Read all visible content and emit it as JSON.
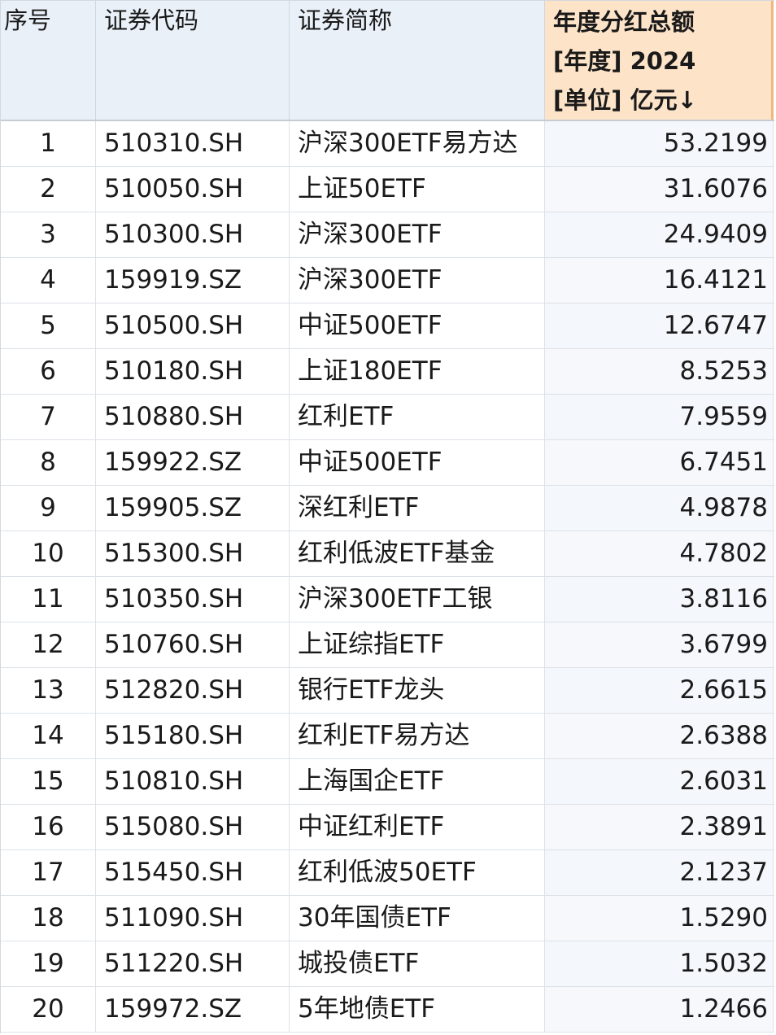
{
  "table": {
    "headers": {
      "index": "序号",
      "code": "证券代码",
      "name": "证券简称",
      "dividend_line1": "年度分红总额",
      "dividend_line2": "[年度] 2024",
      "dividend_line3": "[单位] 亿元↓"
    },
    "rows": [
      {
        "index": "1",
        "code": "510310.SH",
        "name": "沪深300ETF易方达",
        "value": "53.2199"
      },
      {
        "index": "2",
        "code": "510050.SH",
        "name": "上证50ETF",
        "value": "31.6076"
      },
      {
        "index": "3",
        "code": "510300.SH",
        "name": "沪深300ETF",
        "value": "24.9409"
      },
      {
        "index": "4",
        "code": "159919.SZ",
        "name": "沪深300ETF",
        "value": "16.4121"
      },
      {
        "index": "5",
        "code": "510500.SH",
        "name": "中证500ETF",
        "value": "12.6747"
      },
      {
        "index": "6",
        "code": "510180.SH",
        "name": "上证180ETF",
        "value": "8.5253"
      },
      {
        "index": "7",
        "code": "510880.SH",
        "name": "红利ETF",
        "value": "7.9559"
      },
      {
        "index": "8",
        "code": "159922.SZ",
        "name": "中证500ETF",
        "value": "6.7451"
      },
      {
        "index": "9",
        "code": "159905.SZ",
        "name": "深红利ETF",
        "value": "4.9878"
      },
      {
        "index": "10",
        "code": "515300.SH",
        "name": "红利低波ETF基金",
        "value": "4.7802"
      },
      {
        "index": "11",
        "code": "510350.SH",
        "name": "沪深300ETF工银",
        "value": "3.8116"
      },
      {
        "index": "12",
        "code": "510760.SH",
        "name": "上证综指ETF",
        "value": "3.6799"
      },
      {
        "index": "13",
        "code": "512820.SH",
        "name": "银行ETF龙头",
        "value": "2.6615"
      },
      {
        "index": "14",
        "code": "515180.SH",
        "name": "红利ETF易方达",
        "value": "2.6388"
      },
      {
        "index": "15",
        "code": "510810.SH",
        "name": "上海国企ETF",
        "value": "2.6031"
      },
      {
        "index": "16",
        "code": "515080.SH",
        "name": "中证红利ETF",
        "value": "2.3891"
      },
      {
        "index": "17",
        "code": "515450.SH",
        "name": "红利低波50ETF",
        "value": "2.1237"
      },
      {
        "index": "18",
        "code": "511090.SH",
        "name": "30年国债ETF",
        "value": "1.5290"
      },
      {
        "index": "19",
        "code": "511220.SH",
        "name": "城投债ETF",
        "value": "1.5032"
      },
      {
        "index": "20",
        "code": "159972.SZ",
        "name": "5年地债ETF",
        "value": "1.2466"
      }
    ]
  },
  "colors": {
    "header_bg": "#e9f0f8",
    "sorted_header_bg": "#fde4c9",
    "sorted_header_border": "#f3b57a"
  }
}
